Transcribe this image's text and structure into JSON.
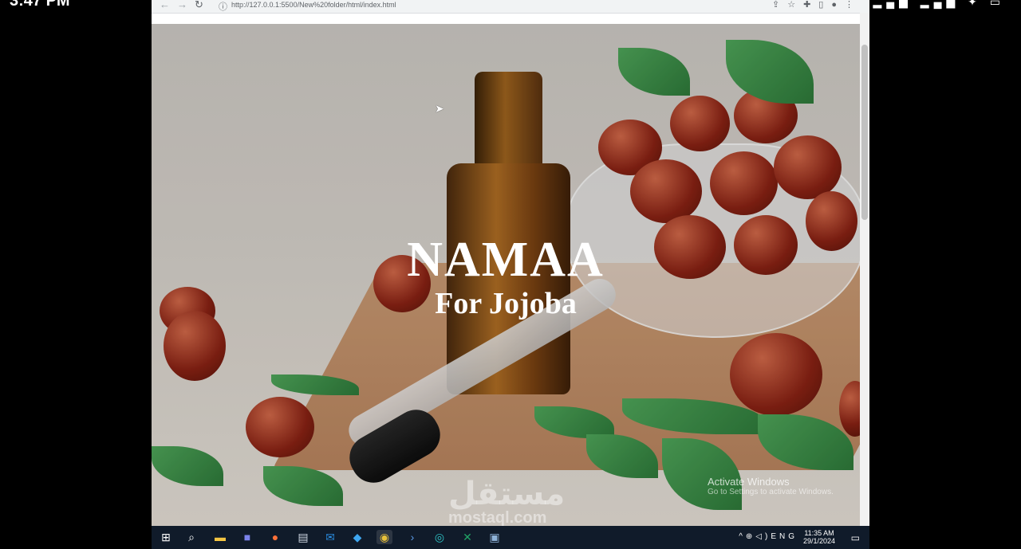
{
  "phone": {
    "clock": "3:47 PM",
    "icons": "▂▄▆ ▂▄▆ ✦ ▭"
  },
  "browser": {
    "url": "http://127.0.0.1:5500/New%20folder/html/index.html",
    "icons": [
      "back-icon",
      "forward-icon",
      "reload-icon",
      "info-icon",
      "share-icon",
      "star-icon",
      "extensions-icon",
      "sidebar-icon",
      "profile-icon",
      "menu-icon"
    ]
  },
  "hero": {
    "title": "NAMAA",
    "subtitle": "For Jojoba"
  },
  "watermark": {
    "line1": "Activate Windows",
    "line2": "Go to Settings to activate Windows."
  },
  "mostaql": {
    "arabic": "مستقل",
    "latin": "mostaql.com"
  },
  "taskbar": {
    "apps": [
      "start-icon",
      "search-icon",
      "file-explorer-icon",
      "teams-icon",
      "firefox-icon",
      "notepad-icon",
      "outlook-icon",
      "vscode-icon",
      "chrome-icon",
      "powershell-icon",
      "edge-icon",
      "excel-icon",
      "app-icon"
    ],
    "language": "ENG",
    "time": "11:35 AM",
    "date": "29/1/2024"
  },
  "colors": {
    "taskbar": "#101b2a",
    "browser_bar": "#f1f3f4"
  }
}
